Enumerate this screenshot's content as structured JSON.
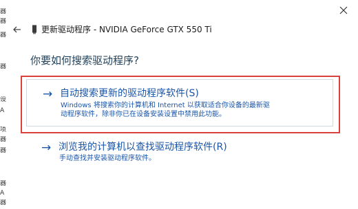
{
  "background_window": {
    "chars": [
      "器",
      "器",
      "器",
      "器",
      "设",
      "A",
      "",
      "项",
      "器",
      "器",
      "",
      "器",
      "A",
      "器"
    ]
  },
  "dialog": {
    "title": "更新驱动程序 - NVIDIA GeForce GTX 550 Ti",
    "question": "你要如何搜索驱动程序?",
    "options": [
      {
        "title": "自动搜索更新的驱动程序软件(S)",
        "description_line1": "Windows 将搜索你的计算机和 Internet 以获取适合你设备的最新驱",
        "description_line2": "动程序软件，除非你已在设备安装设置中禁用此功能。"
      },
      {
        "title": "浏览我的计算机以查找驱动程序软件(R)",
        "description_line1": "手动查找并安装驱动程序软件。"
      }
    ],
    "colors": {
      "link": "#1a55a8",
      "highlight_border": "#d9413b",
      "heading": "#1e3f5a"
    },
    "icons": {
      "close": "close-icon",
      "back": "back-arrow-icon",
      "device": "device-icon",
      "option_arrow": "right-arrow-icon"
    }
  }
}
